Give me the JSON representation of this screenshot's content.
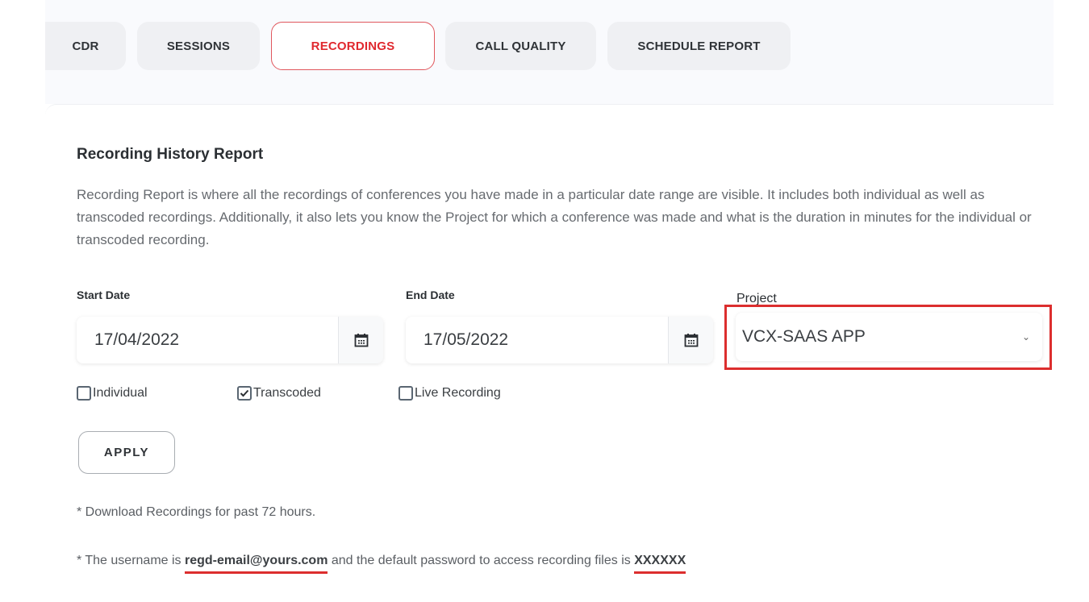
{
  "tabs": [
    {
      "label": "CDR",
      "active": false
    },
    {
      "label": "SESSIONS",
      "active": false
    },
    {
      "label": "RECORDINGS",
      "active": true
    },
    {
      "label": "CALL QUALITY",
      "active": false
    },
    {
      "label": "SCHEDULE REPORT",
      "active": false
    }
  ],
  "report": {
    "title": "Recording History Report",
    "description": "Recording Report is where all the recordings of conferences you have made in a particular date range are visible. It includes both individual as well as transcoded recordings. Additionally, it also lets you know the Project for which a conference was made and what is the duration in minutes for the individual or transcoded recording."
  },
  "filters": {
    "start_date": {
      "label": "Start Date",
      "value": "17/04/2022",
      "icon": "calendar-icon"
    },
    "end_date": {
      "label": "End Date",
      "value": "17/05/2022",
      "icon": "calendar-icon"
    },
    "project": {
      "label": "Project",
      "value": "VCX-SAAS APP",
      "icon": "chevron-down-icon"
    },
    "checkboxes": [
      {
        "label": "Individual",
        "checked": false
      },
      {
        "label": "Transcoded",
        "checked": true
      },
      {
        "label": "Live Recording",
        "checked": false
      }
    ],
    "apply_label": "APPLY"
  },
  "notes": {
    "download": "* Download Recordings for past 72 hours.",
    "credentials_prefix": "* The username is ",
    "username": "regd-email@yours.com",
    "credentials_middle": " and the default password to access recording files is ",
    "password": "XXXXXX"
  },
  "colors": {
    "accent": "#e0282e",
    "highlight": "#dc2e2e"
  }
}
